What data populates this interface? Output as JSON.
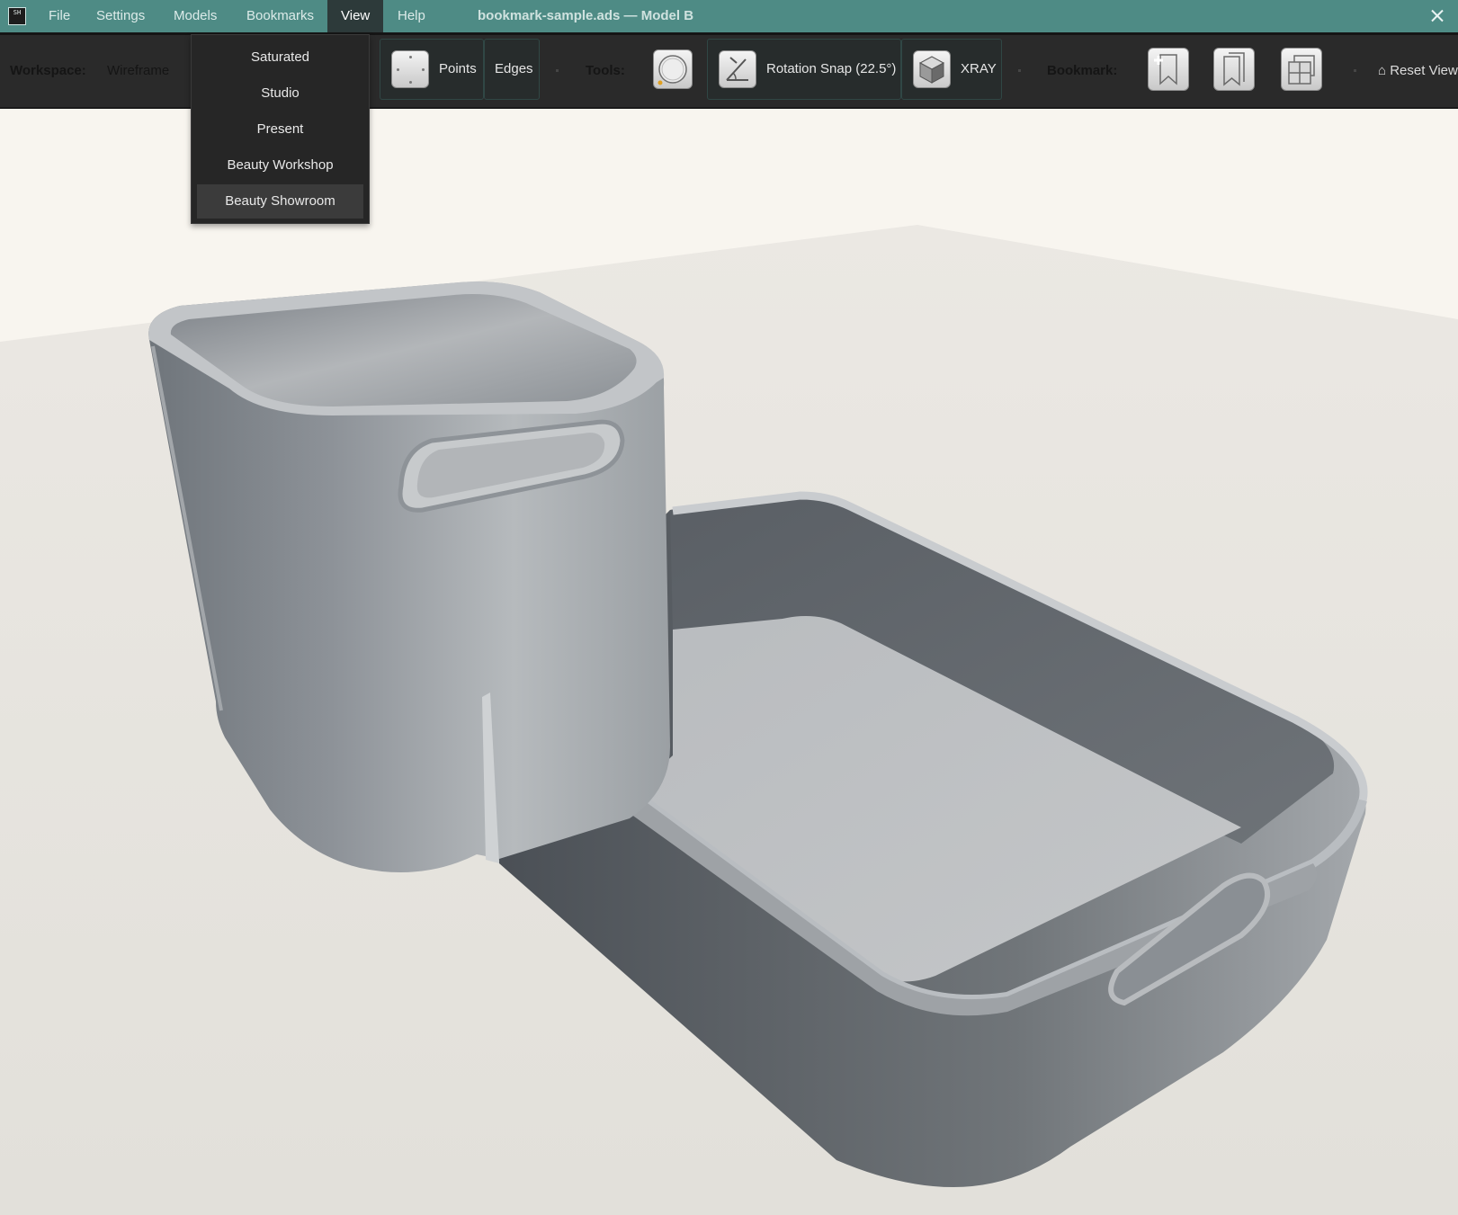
{
  "app": {
    "logo_text": "SH",
    "window_title": "bookmark-sample.ads — Model B",
    "close_icon": "close-icon"
  },
  "menu": [
    {
      "label": "File"
    },
    {
      "label": "Settings"
    },
    {
      "label": "Models"
    },
    {
      "label": "Bookmarks"
    },
    {
      "label": "View",
      "open": true
    },
    {
      "label": "Help"
    }
  ],
  "toolbar": {
    "workspace_label": "Workspace:",
    "workspace_value": "Wireframe",
    "points_label": "Points",
    "edges_label": "Edges",
    "tools_label": "Tools:",
    "rotation_snap_label": "Rotation Snap (22.5°)",
    "xray_label": "XRAY",
    "bookmark_label": "Bookmark:",
    "reset_view_label": "⌂ Reset View"
  },
  "view_menu": {
    "items": [
      "Saturated",
      "Studio",
      "Present",
      "Beauty Workshop",
      "Beauty Showroom"
    ],
    "highlighted": "Beauty Showroom"
  },
  "colors": {
    "titlebar": "#4e8b85",
    "toolbar": "#2a2a2a",
    "viewport_background": "#f8f5ef",
    "model": "#a9adb1"
  }
}
